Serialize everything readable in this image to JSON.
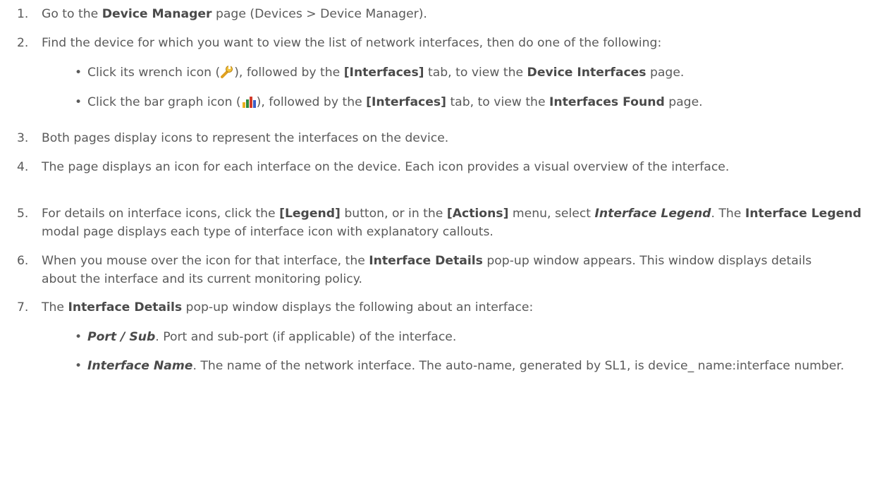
{
  "steps": [
    {
      "num": "1.",
      "pre": "Go to the ",
      "bold": "Device Manager",
      "post": " page (Devices > Device Manager)."
    },
    {
      "num": "2.",
      "text": "Find the device for which you want to view the list of network interfaces, then do one of the following:"
    },
    {
      "num": "3.",
      "text": "Both pages display icons to represent the interfaces on the device."
    },
    {
      "num": "4.",
      "text": "The page displays an icon for each interface on the device. Each icon provides a visual overview of the interface."
    },
    {
      "num": "5.",
      "a": "For details on interface icons, click the ",
      "b1": "[Legend]",
      "c": " button, or in the ",
      "b2": "[Actions]",
      "d": " menu, select ",
      "i1": "Interface Legend",
      "e": ". The ",
      "b3": "Interface Legend",
      "f": " modal page displays each type of interface icon with explanatory callouts."
    },
    {
      "num": "6.",
      "a": "When you mouse over the icon for that interface, the ",
      "b1": "Interface Details",
      "c": " pop-up window appears. This window displays details about the interface and its current monitoring policy."
    },
    {
      "num": "7.",
      "a": "The ",
      "b1": "Interface Details",
      "c": " pop-up window displays the following about an interface:"
    }
  ],
  "step2_bullets": [
    {
      "dot": "•",
      "a": "Click its wrench icon (",
      "icon": "wrench-icon",
      "b": "), followed by the ",
      "b1": "[Interfaces]",
      "c": " tab, to view the ",
      "b2": "Device Interfaces",
      "d": " page."
    },
    {
      "dot": "•",
      "a": "Click the bar graph icon (",
      "icon": "bar-graph-icon",
      "b": "), followed by the ",
      "b1": "[Interfaces]",
      "c": " tab, to view the ",
      "b2": "Interfaces Found",
      "d": " page."
    }
  ],
  "step7_bullets": [
    {
      "dot": "•",
      "bi": "Port / Sub",
      "text": ". Port and sub-port (if applicable) of the interface."
    },
    {
      "dot": "•",
      "bi": "Interface Name",
      "text": ". The name of the network interface. The auto-name, generated by SL1, is device_ name:interface  number."
    }
  ]
}
